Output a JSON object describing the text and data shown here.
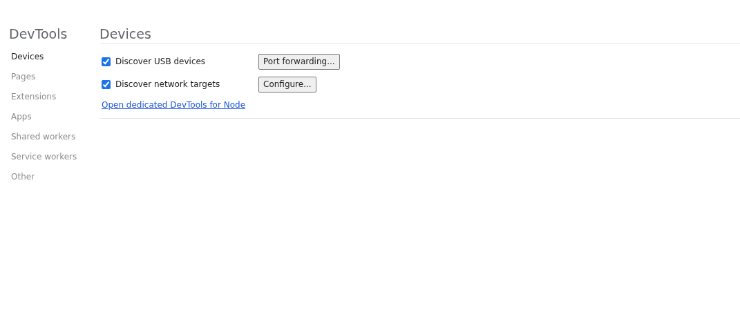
{
  "sidebar": {
    "title": "DevTools",
    "items": [
      {
        "label": "Devices",
        "selected": true
      },
      {
        "label": "Pages",
        "selected": false
      },
      {
        "label": "Extensions",
        "selected": false
      },
      {
        "label": "Apps",
        "selected": false
      },
      {
        "label": "Shared workers",
        "selected": false
      },
      {
        "label": "Service workers",
        "selected": false
      },
      {
        "label": "Other",
        "selected": false
      }
    ]
  },
  "main": {
    "title": "Devices",
    "options": [
      {
        "label": "Discover USB devices",
        "checked": true,
        "button": "Port forwarding..."
      },
      {
        "label": "Discover network targets",
        "checked": true,
        "button": "Configure..."
      }
    ],
    "link": "Open dedicated DevTools for Node"
  }
}
